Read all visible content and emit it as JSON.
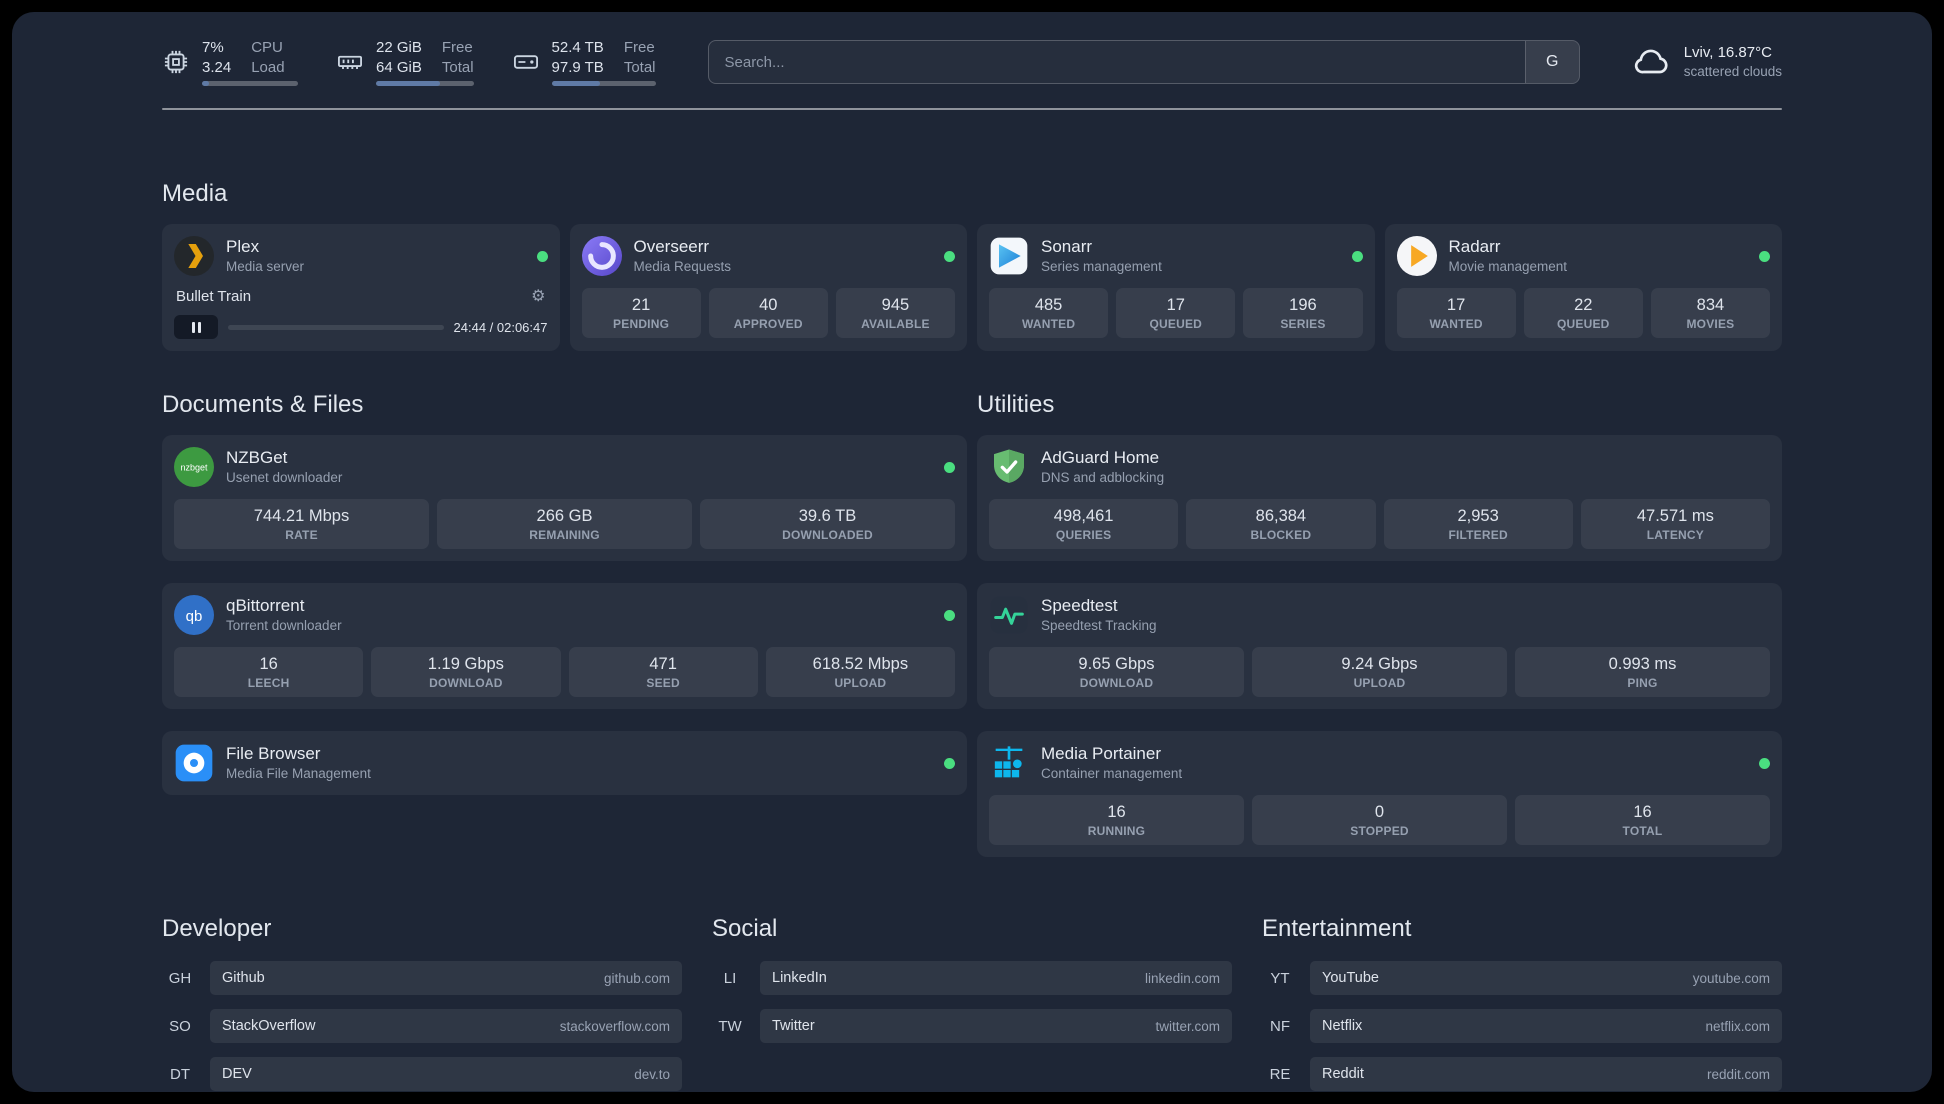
{
  "colors": {
    "status_online": "#4ade80",
    "plex_accent": "#e5a00d",
    "radarr_accent": "#f7a824",
    "sonarr_accent": "#2193d1",
    "nzbget_accent": "#3d9a41",
    "adguard_accent": "#68bc71",
    "portainer_accent": "#0db7ed",
    "speedtest_accent": "#34d399"
  },
  "icons": {
    "gear_glyph": "⚙",
    "nzbget_glyph": "nzbget",
    "qbittorrent_glyph": "qb"
  },
  "header": {
    "cpu": {
      "percent_label": "7%",
      "load_value": "3.24",
      "label_line1": "CPU",
      "label_line2": "Load",
      "bar_percent": 7
    },
    "memory": {
      "free_value": "22 GiB",
      "total_value": "64 GiB",
      "label_line1": "Free",
      "label_line2": "Total",
      "bar_percent": 66
    },
    "disk": {
      "free_value": "52.4 TB",
      "total_value": "97.9 TB",
      "label_line1": "Free",
      "label_line2": "Total",
      "bar_percent": 47
    },
    "search": {
      "placeholder": "Search...",
      "provider_label": "G"
    },
    "weather": {
      "location_temp": "Lviv, 16.87°C",
      "description": "scattered clouds"
    }
  },
  "sections": {
    "media": {
      "title": "Media",
      "plex": {
        "name": "Plex",
        "subtitle": "Media server",
        "now_playing": {
          "title": "Bullet Train",
          "time": "24:44 / 02:06:47"
        }
      },
      "overseerr": {
        "name": "Overseerr",
        "subtitle": "Media Requests",
        "stats": [
          {
            "value": "21",
            "label": "PENDING"
          },
          {
            "value": "40",
            "label": "APPROVED"
          },
          {
            "value": "945",
            "label": "AVAILABLE"
          }
        ]
      },
      "sonarr": {
        "name": "Sonarr",
        "subtitle": "Series management",
        "stats": [
          {
            "value": "485",
            "label": "WANTED"
          },
          {
            "value": "17",
            "label": "QUEUED"
          },
          {
            "value": "196",
            "label": "SERIES"
          }
        ]
      },
      "radarr": {
        "name": "Radarr",
        "subtitle": "Movie management",
        "stats": [
          {
            "value": "17",
            "label": "WANTED"
          },
          {
            "value": "22",
            "label": "QUEUED"
          },
          {
            "value": "834",
            "label": "MOVIES"
          }
        ]
      }
    },
    "documents": {
      "title": "Documents & Files",
      "nzbget": {
        "name": "NZBGet",
        "subtitle": "Usenet downloader",
        "stats": [
          {
            "value": "744.21 Mbps",
            "label": "RATE"
          },
          {
            "value": "266 GB",
            "label": "REMAINING"
          },
          {
            "value": "39.6 TB",
            "label": "DOWNLOADED"
          }
        ]
      },
      "qbittorrent": {
        "name": "qBittorrent",
        "subtitle": "Torrent downloader",
        "stats": [
          {
            "value": "16",
            "label": "LEECH"
          },
          {
            "value": "1.19 Gbps",
            "label": "DOWNLOAD"
          },
          {
            "value": "471",
            "label": "SEED"
          },
          {
            "value": "618.52 Mbps",
            "label": "UPLOAD"
          }
        ]
      },
      "filebrowser": {
        "name": "File Browser",
        "subtitle": "Media File Management"
      }
    },
    "utilities": {
      "title": "Utilities",
      "adguard": {
        "name": "AdGuard Home",
        "subtitle": "DNS and adblocking",
        "stats": [
          {
            "value": "498,461",
            "label": "QUERIES"
          },
          {
            "value": "86,384",
            "label": "BLOCKED"
          },
          {
            "value": "2,953",
            "label": "FILTERED"
          },
          {
            "value": "47.571 ms",
            "label": "LATENCY"
          }
        ]
      },
      "speedtest": {
        "name": "Speedtest",
        "subtitle": "Speedtest Tracking",
        "stats": [
          {
            "value": "9.65 Gbps",
            "label": "DOWNLOAD"
          },
          {
            "value": "9.24 Gbps",
            "label": "UPLOAD"
          },
          {
            "value": "0.993 ms",
            "label": "PING"
          }
        ]
      },
      "portainer": {
        "name": "Media Portainer",
        "subtitle": "Container management",
        "stats": [
          {
            "value": "16",
            "label": "RUNNING"
          },
          {
            "value": "0",
            "label": "STOPPED"
          },
          {
            "value": "16",
            "label": "TOTAL"
          }
        ]
      }
    },
    "bookmarks": {
      "developer": {
        "title": "Developer",
        "items": [
          {
            "abbr": "GH",
            "name": "Github",
            "url": "github.com"
          },
          {
            "abbr": "SO",
            "name": "StackOverflow",
            "url": "stackoverflow.com"
          },
          {
            "abbr": "DT",
            "name": "DEV",
            "url": "dev.to"
          }
        ]
      },
      "social": {
        "title": "Social",
        "items": [
          {
            "abbr": "LI",
            "name": "LinkedIn",
            "url": "linkedin.com"
          },
          {
            "abbr": "TW",
            "name": "Twitter",
            "url": "twitter.com"
          }
        ]
      },
      "entertainment": {
        "title": "Entertainment",
        "items": [
          {
            "abbr": "YT",
            "name": "YouTube",
            "url": "youtube.com"
          },
          {
            "abbr": "NF",
            "name": "Netflix",
            "url": "netflix.com"
          },
          {
            "abbr": "RE",
            "name": "Reddit",
            "url": "reddit.com"
          }
        ]
      }
    }
  }
}
